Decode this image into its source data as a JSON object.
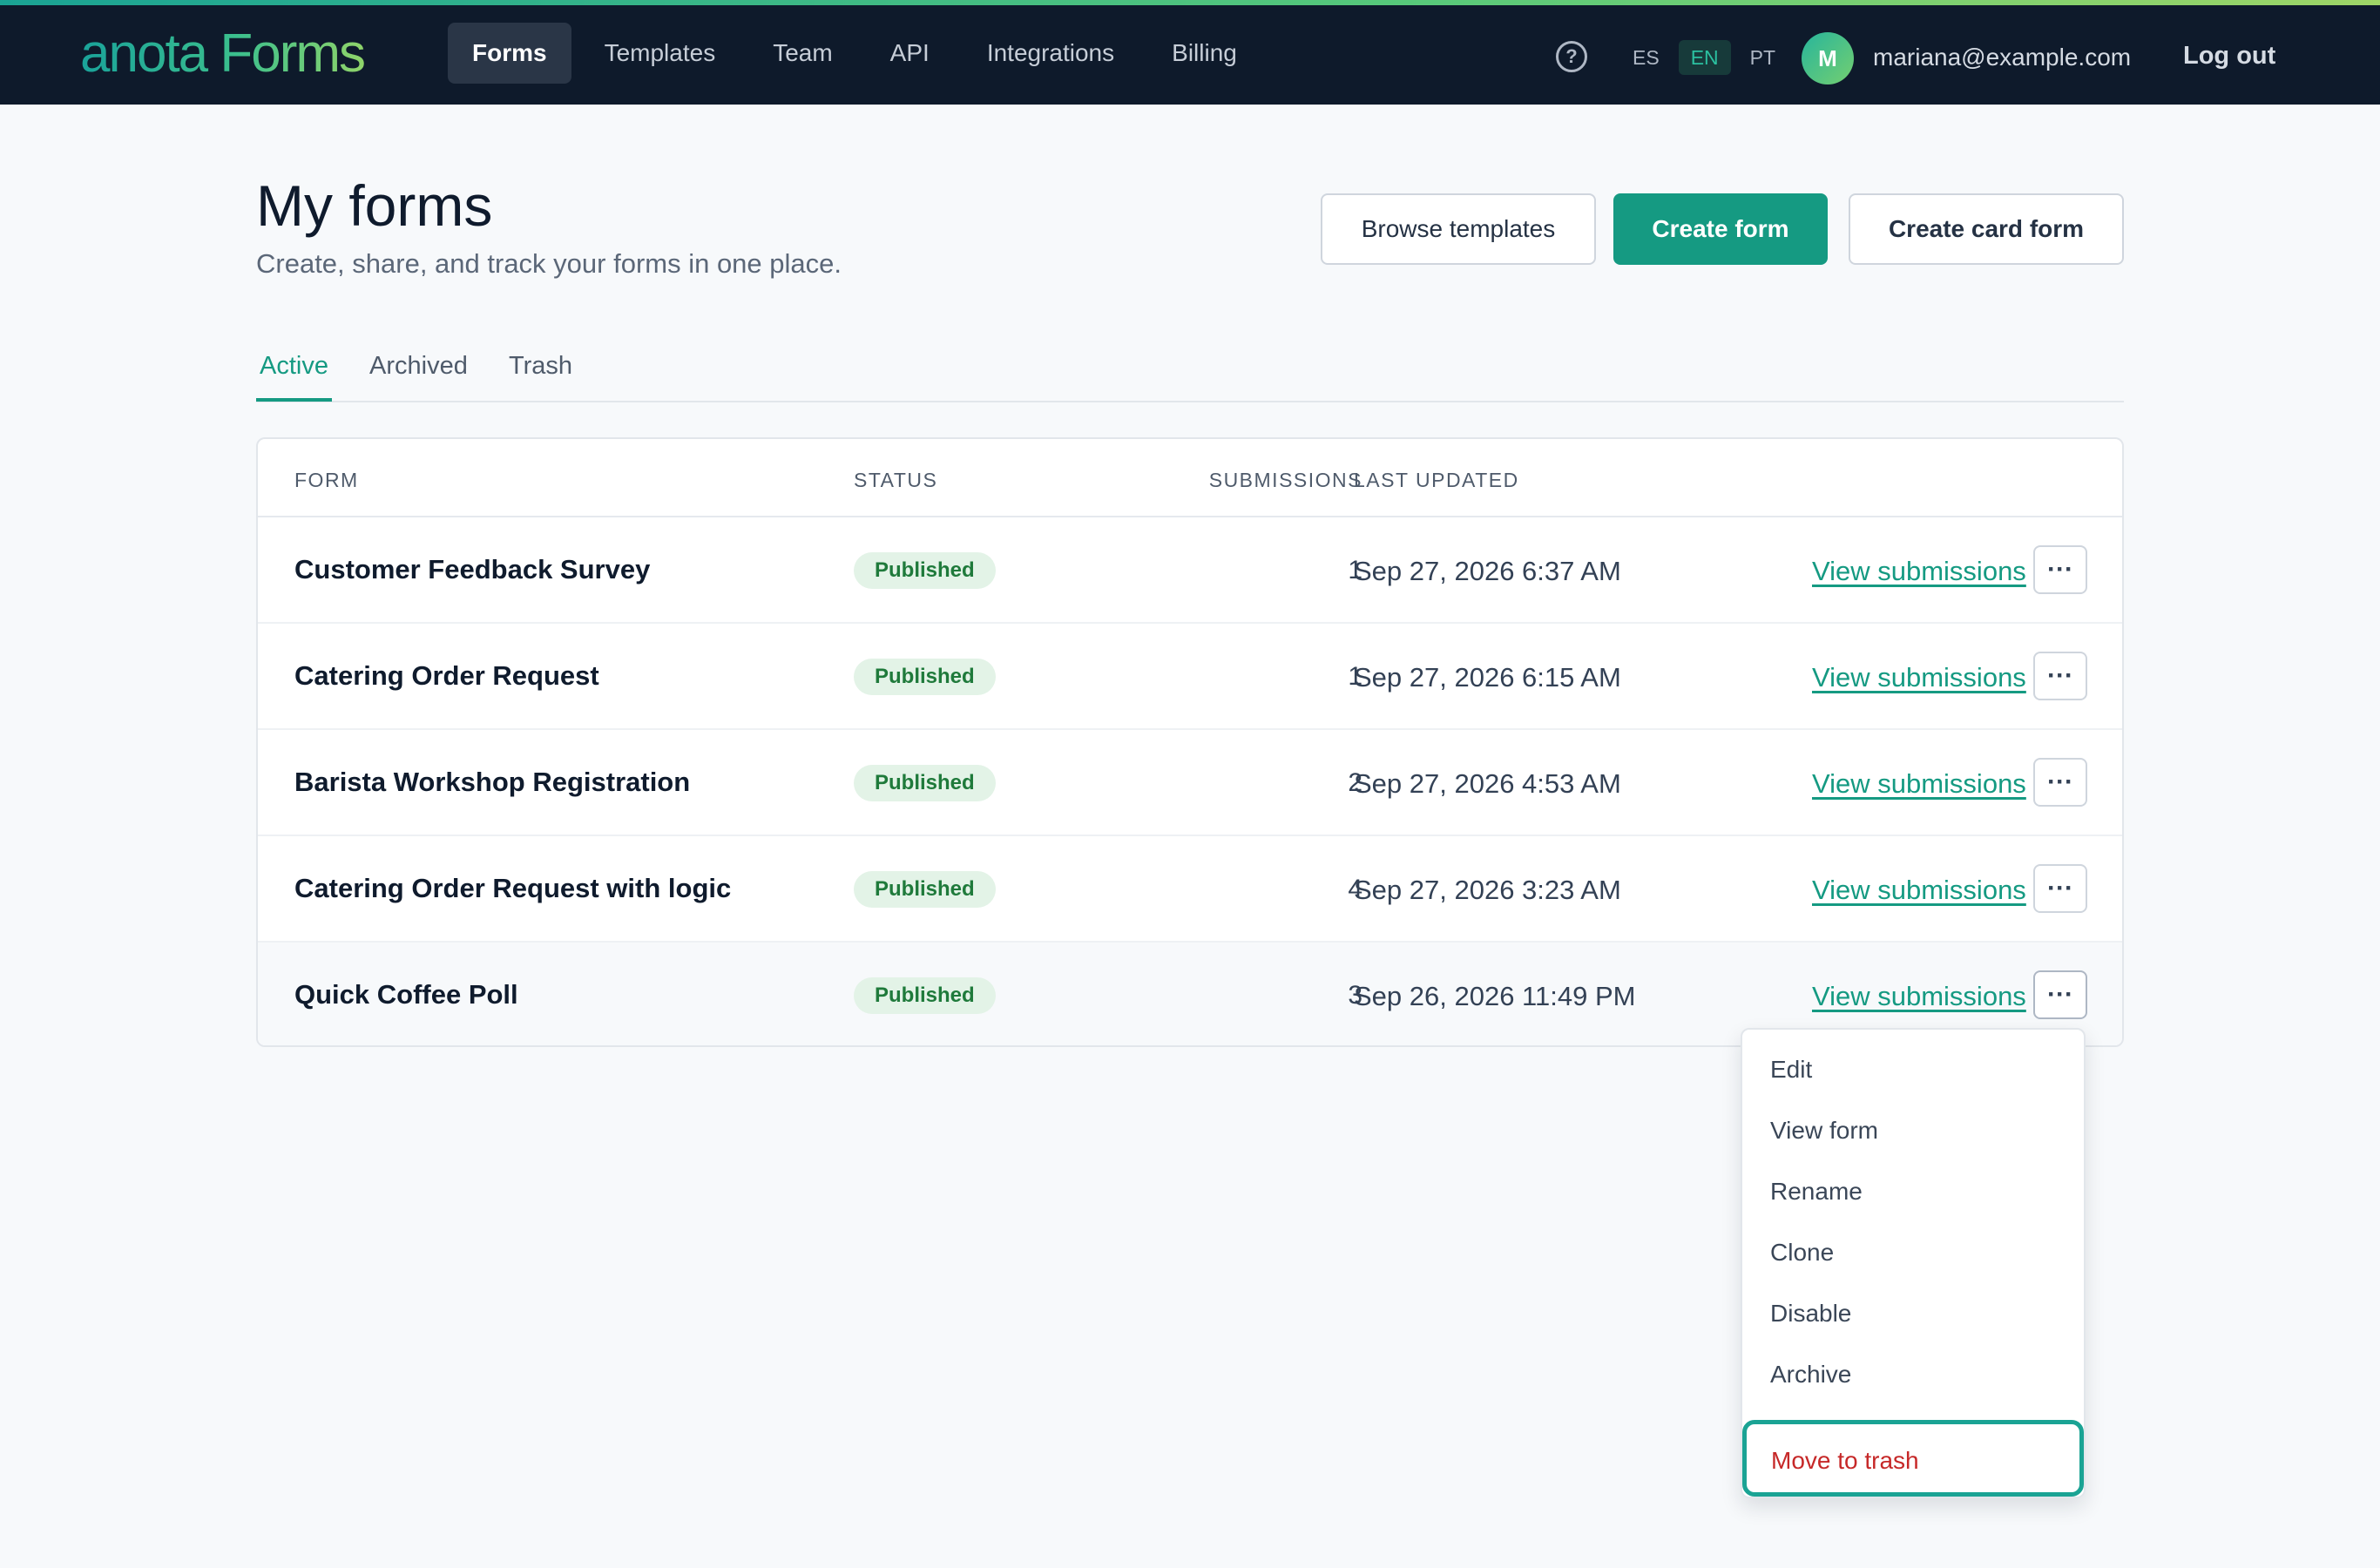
{
  "app": {
    "logo_text": "anota Forms"
  },
  "nav": {
    "items": [
      "Forms",
      "Templates",
      "Team",
      "API",
      "Integrations",
      "Billing"
    ],
    "active_index": 0
  },
  "header_right": {
    "help_icon": "question-circle-icon",
    "help_glyph": "?",
    "languages": [
      "ES",
      "EN",
      "PT"
    ],
    "active_language": "EN",
    "avatar_initial": "M",
    "user_email": "mariana@example.com",
    "logout_label": "Log out"
  },
  "page": {
    "title": "My forms",
    "subtitle": "Create, share, and track your forms in one place."
  },
  "actions": {
    "browse_templates": "Browse templates",
    "create_form": "Create form",
    "create_card_form": "Create card form"
  },
  "tabs": [
    "Active",
    "Archived",
    "Trash"
  ],
  "table": {
    "columns": {
      "form": "FORM",
      "status": "STATUS",
      "submissions": "SUBMISSIONS",
      "last_updated": "LAST UPDATED"
    },
    "view_label": "View submissions",
    "more_glyph": "···",
    "rows": [
      {
        "name": "Customer Feedback Survey",
        "status": "Published",
        "submissions": "1",
        "updated": "Sep 27, 2026 6:37 AM"
      },
      {
        "name": "Catering Order Request",
        "status": "Published",
        "submissions": "1",
        "updated": "Sep 27, 2026 6:15 AM"
      },
      {
        "name": "Barista Workshop Registration",
        "status": "Published",
        "submissions": "2",
        "updated": "Sep 27, 2026 4:53 AM"
      },
      {
        "name": "Catering Order Request with logic",
        "status": "Published",
        "submissions": "4",
        "updated": "Sep 27, 2026 3:23 AM"
      },
      {
        "name": "Quick Coffee Poll",
        "status": "Published",
        "submissions": "3",
        "updated": "Sep 26, 2026 11:49 PM"
      }
    ]
  },
  "menu": {
    "items": [
      "Edit",
      "View form",
      "Rename",
      "Clone",
      "Disable",
      "Archive"
    ],
    "danger_item": "Move to trash"
  },
  "colors": {
    "brand": "#159a82",
    "nav_bg": "#0e1a2b",
    "danger": "#c62828",
    "badge_bg": "#e3f3e7",
    "badge_text": "#1f7a3b"
  }
}
